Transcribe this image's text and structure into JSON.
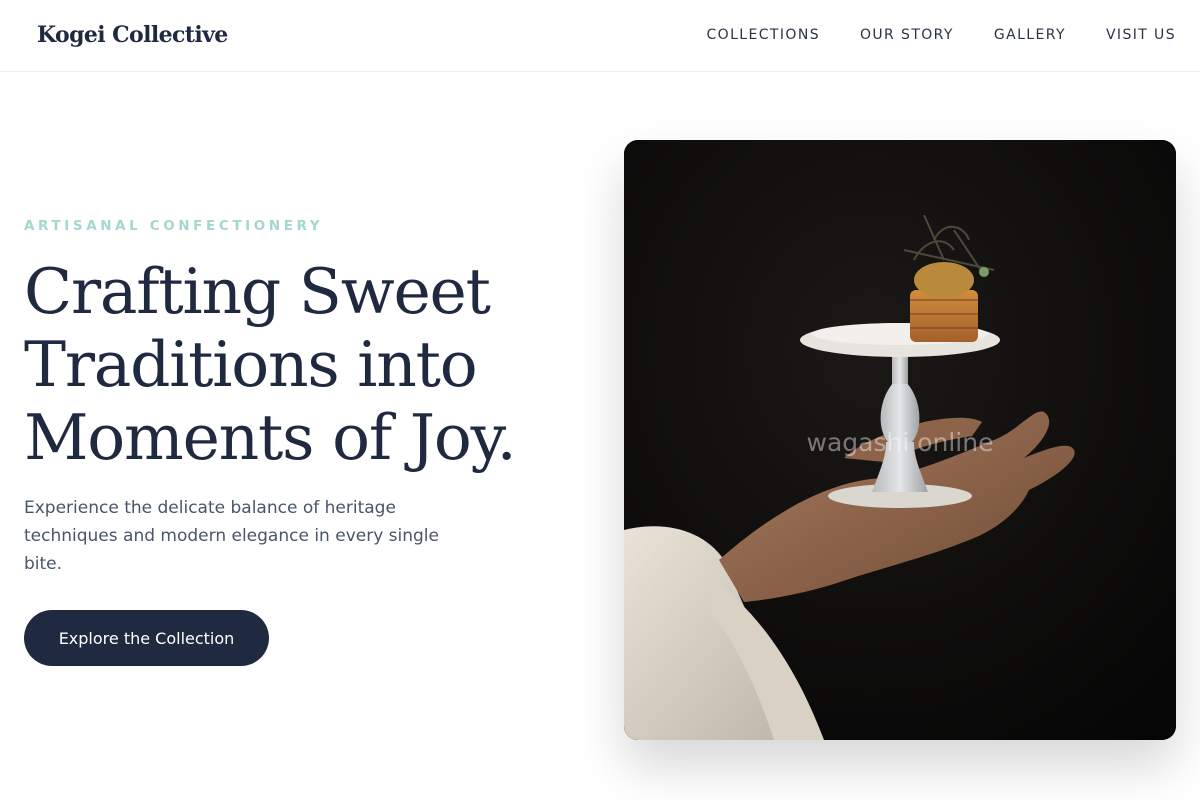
{
  "header": {
    "logo": "Kogei Collective",
    "nav": [
      "COLLECTIONS",
      "OUR STORY",
      "GALLERY",
      "VISIT US"
    ]
  },
  "hero": {
    "eyebrow": "ARTISANAL CONFECTIONERY",
    "headline_lines": [
      "Crafting Sweet",
      "Traditions into",
      "Moments of Joy."
    ],
    "lead": "Experience the delicate balance of heritage techniques and modern elegance in every single bite.",
    "cta_label": "Explore the Collection",
    "image_watermark": "wagashi online"
  },
  "colors": {
    "primary": "#1f2a40",
    "eyebrow": "#a5d6cf",
    "body_text": "#4a5568",
    "photo_background": "#0a0a0a"
  }
}
